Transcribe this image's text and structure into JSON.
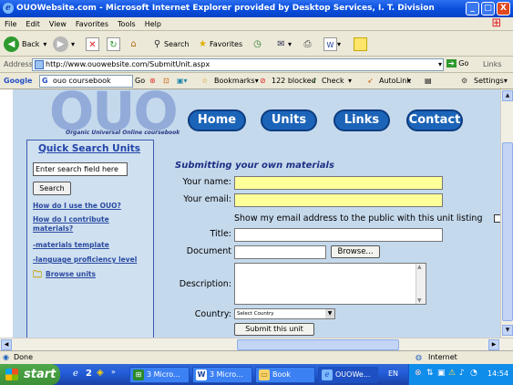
{
  "window": {
    "title": "OUOWebsite.com - Microsoft Internet Explorer provided by Desktop Services, I. T. Division",
    "min": "_",
    "max": "□",
    "close": "X"
  },
  "menu": [
    "File",
    "Edit",
    "View",
    "Favorites",
    "Tools",
    "Help"
  ],
  "toolbar": {
    "back": "Back",
    "search": "Search",
    "favorites": "Favorites"
  },
  "address": {
    "label": "Address",
    "url": "http://www.ouowebsite.com/SubmitUnit.aspx",
    "go": "Go",
    "links": "Links"
  },
  "googlebar": {
    "brand": "Google",
    "query": "ouo coursebook",
    "go": "Go",
    "bookmarks": "Bookmarks▾",
    "blocked": "122 blocked",
    "check": "Check",
    "autolink": "AutoLink",
    "settings": "Settings▾"
  },
  "site": {
    "logo": "OUO",
    "tagline": "Organic Universal Online coursebook",
    "nav": [
      "Home",
      "Units",
      "Links",
      "Contact"
    ],
    "quick_search": {
      "heading": "Quick Search Units",
      "placeholder": "Enter search field here",
      "button": "Search"
    },
    "sidebar_links": [
      "How do I use the OUO?",
      "How do I contribute materials?",
      "-materials template",
      "-language proficiency level",
      "Browse units"
    ]
  },
  "form": {
    "title": "Submitting your own materials",
    "your_name": "Your name:",
    "your_email": "Your email:",
    "show_email": "Show my email address to the public with this unit listing",
    "title_label": "Title:",
    "document": "Document",
    "browse": "Browse...",
    "description": "Description:",
    "country": "Country:",
    "country_value": "Select Country",
    "submit": "Submit this unit"
  },
  "status": {
    "left": "Done",
    "zone": "Internet"
  },
  "taskbar": {
    "start": "start",
    "quick_count": "2",
    "tasks": [
      "3 Micro...",
      "3 Micro...",
      "Book",
      "OUOWe..."
    ],
    "lang": "EN",
    "time": "14:54"
  }
}
